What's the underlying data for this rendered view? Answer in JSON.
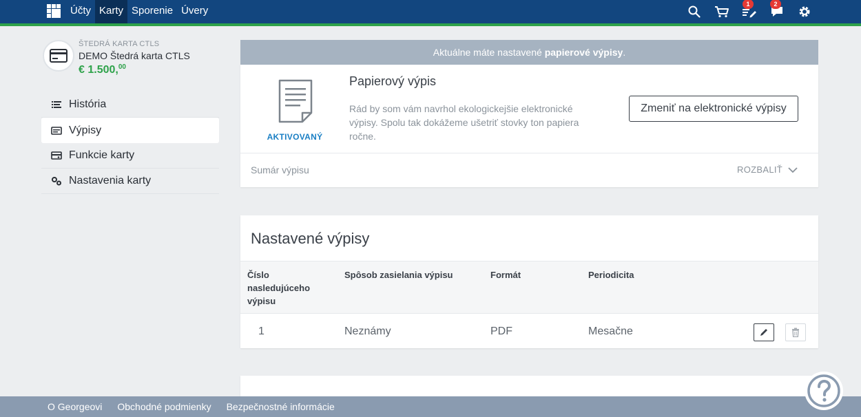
{
  "nav": {
    "items": [
      {
        "label": "Účty",
        "active": false
      },
      {
        "label": "Karty",
        "active": true
      },
      {
        "label": "Sporenie",
        "active": false
      },
      {
        "label": "Úvery",
        "active": false
      }
    ],
    "badges": {
      "tasks": "1",
      "messages": "2"
    },
    "icons": [
      "search-icon",
      "cart-icon",
      "tasks-icon",
      "messages-icon",
      "settings-icon"
    ]
  },
  "card": {
    "type": "ŠTEDRÁ KARTA CTLS",
    "name": "DEMO Štedrá karta CTLS",
    "balance_main": "€ 1.500,",
    "balance_cents": "00"
  },
  "sidebar": {
    "items": [
      {
        "label": "História",
        "icon": "history-icon"
      },
      {
        "label": "Výpisy",
        "icon": "statements-icon",
        "active": true
      },
      {
        "label": "Funkcie karty",
        "icon": "card-functions-icon"
      },
      {
        "label": "Nastavenia karty",
        "icon": "card-settings-icon"
      }
    ]
  },
  "banner": {
    "prefix": "Aktuálne máte nastavené ",
    "bold": "papierové výpisy",
    "suffix": "."
  },
  "paper": {
    "status": "AKTIVOVANÝ",
    "title": "Papierový výpis",
    "description": "Rád by som vám navrhol ekologickejšie elektronické výpisy. Spolu tak dokážeme ušetriť stovky ton papiera ročne.",
    "button": "Zmeniť na elektronické výpisy",
    "summary": "Sumár výpisu",
    "expand": "ROZBALIŤ"
  },
  "statements": {
    "title": "Nastavené výpisy",
    "headers": [
      "Číslo nasledujúceho výpisu",
      "Spôsob zasielania výpisu",
      "Formát",
      "Periodicita"
    ],
    "header_lines": [
      [
        "Číslo",
        "nasledujúceho",
        "výpisu"
      ],
      [
        "Spôsob zasielania výpisu"
      ],
      [
        "Formát"
      ],
      [
        "Periodicita"
      ]
    ],
    "rows": [
      {
        "number": "1",
        "method": "Neznámy",
        "format": "PDF",
        "period": "Mesačne"
      }
    ]
  },
  "footer": {
    "links": [
      "O Georgeovi",
      "Obchodné podmienky",
      "Bezpečnostné informácie"
    ]
  },
  "colors": {
    "topbar": "#12467f",
    "accent_green": "#2ea24a",
    "link_blue": "#1a7fc4",
    "banner": "#a6b3c1",
    "footer": "#8a9bb0"
  }
}
